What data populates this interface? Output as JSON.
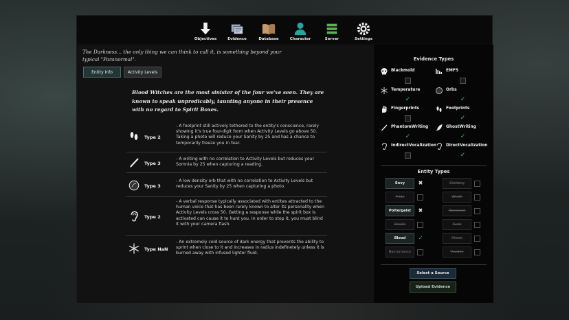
{
  "nav": [
    {
      "label": "Objectives",
      "icon": "arrow-down-icon"
    },
    {
      "label": "Evidence",
      "icon": "evidence-icon"
    },
    {
      "label": "Database",
      "icon": "book-icon"
    },
    {
      "label": "Character",
      "icon": "person-icon"
    },
    {
      "label": "Server",
      "icon": "server-icon"
    },
    {
      "label": "Settings",
      "icon": "gear-icon"
    }
  ],
  "intro": "The Darkness... the only thing we can think to call it, is something beyond your typical \"Paranormal\".",
  "tabs": {
    "entity_info": "Entity Info",
    "activity_levels": "Activity Levels"
  },
  "description": "Blood Witches are the most sinister of the four we've seen. They are known to speak unpredicably, taunting anyone in their presence with no regard to Spirit Boxes.",
  "evidence": [
    {
      "icon": "footprint-icon",
      "type": "Type 2",
      "text": "- A footprint still actively tethered to the entity's conscience, rarely showing it's true four-digit form when Activity Levels go above 50. Taking a photo will reduce your Sanity by 25 and has a chance to temporarily freeze you in fear."
    },
    {
      "icon": "pen-icon",
      "type": "Type 3",
      "text": "- A writing with no correlation to Activity Levels but reduces your Somnia by 25 when capturing a reading."
    },
    {
      "icon": "orb-icon",
      "type": "Type 3",
      "text": "- A low density orb that with no correlation to Activity Levels but reduces your Sanity by 25 when capturing a photo."
    },
    {
      "icon": "ear-icon",
      "type": "Type 2",
      "text": "- A verbal response typically associated with entites attracted to the human voice that has been rarely known to alter its personality when Activity Levels cross 50. Getting a response while the spirit box is activated can cause it to hunt you. In order to stop it, you must blind it with your camera flash."
    },
    {
      "icon": "snowflake-icon",
      "type": "Type NaN",
      "text": "- An extremely cold source of dark energy that prevents the ability to sprint when close to it and increases in radius indefinetely unless it is burned away with infused lighter fluid."
    }
  ],
  "evidence_types_title": "Evidence Types",
  "evidence_types": [
    {
      "label": "Blackmold",
      "icon": "skull-icon",
      "checked": false
    },
    {
      "label": "EMF5",
      "icon": "emf-icon",
      "checked": false
    },
    {
      "label": "Temperature",
      "icon": "snowflake-icon",
      "checked": true
    },
    {
      "label": "Orbs",
      "icon": "orb-icon",
      "checked": true
    },
    {
      "label": "Fingerprints",
      "icon": "hand-icon",
      "checked": false
    },
    {
      "label": "Footprints",
      "icon": "footprint-icon",
      "checked": true
    },
    {
      "label": "PhantomWriting",
      "icon": "pen-icon",
      "checked": true
    },
    {
      "label": "GhostWriting",
      "icon": "quill-icon",
      "checked": true
    },
    {
      "label": "IndirectVocalization",
      "icon": "ear-icon",
      "checked": false
    },
    {
      "label": "DirectVocalization",
      "icon": "ear-icon",
      "checked": true
    }
  ],
  "entity_types_title": "Entity Types",
  "entity_types": [
    {
      "name": "Envy",
      "state": "normal",
      "mark": "x"
    },
    {
      "name": "Gluttony",
      "state": "struck",
      "mark": "box"
    },
    {
      "name": "Pride",
      "state": "struck",
      "mark": "box"
    },
    {
      "name": "Wrath",
      "state": "struck",
      "mark": "box"
    },
    {
      "name": "Poltergeist",
      "state": "normal",
      "mark": "x"
    },
    {
      "name": "Revenant",
      "state": "struck",
      "mark": "box"
    },
    {
      "name": "Wraith",
      "state": "struck",
      "mark": "box"
    },
    {
      "name": "Furst",
      "state": "struck",
      "mark": "box"
    },
    {
      "name": "Blood",
      "state": "normal",
      "mark": "check"
    },
    {
      "name": "Chaos",
      "state": "struck",
      "mark": "box"
    },
    {
      "name": "Necromancy",
      "state": "dim",
      "mark": "box"
    },
    {
      "name": "Voodoo",
      "state": "struck",
      "mark": "box"
    }
  ],
  "select_source": "Select a Source",
  "upload_evidence": "Upload Evidence",
  "colors": {
    "check": "#3ec85a",
    "active_tab": "#233636"
  }
}
